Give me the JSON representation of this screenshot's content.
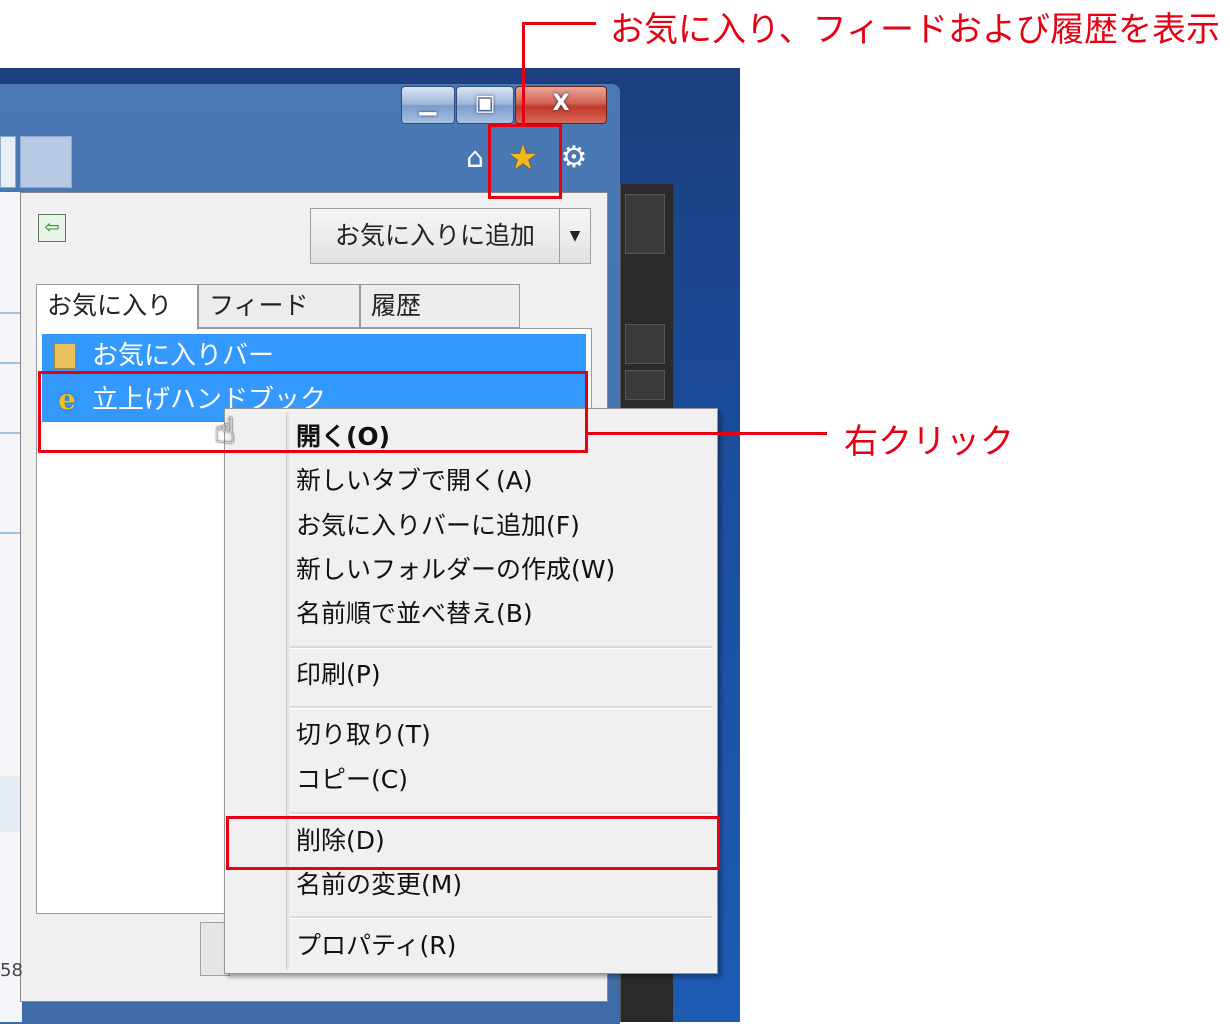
{
  "window": {
    "controls": {
      "minimize": "▁",
      "maximize": "▣",
      "close": "X"
    }
  },
  "toolbar": {
    "home_icon": "⌂",
    "favorites_icon": "★",
    "settings_icon": "⚙"
  },
  "flyout": {
    "pin_icon": "⇦",
    "add_favorites_label": "お気に入りに追加",
    "add_favorites_dropdown": "▼",
    "tabs": [
      {
        "label": "お気に入り"
      },
      {
        "label": "フィード"
      },
      {
        "label": "履歴"
      }
    ],
    "items": [
      {
        "label": "お気に入りバー",
        "icon": "folder-icon"
      },
      {
        "label": "立上げハンドブック",
        "icon": "ie-icon"
      }
    ],
    "status_number": "58"
  },
  "cursor": "☝",
  "context_menu": {
    "items": [
      {
        "label": "開く(O)",
        "bold": true
      },
      {
        "label": "新しいタブで開く(A)"
      },
      {
        "label": "お気に入りバーに追加(F)"
      },
      {
        "label": "新しいフォルダーの作成(W)"
      },
      {
        "label": "名前順で並べ替え(B)"
      },
      {
        "label": "印刷(P)"
      },
      {
        "label": "切り取り(T)"
      },
      {
        "label": "コピー(C)"
      },
      {
        "label": "削除(D)"
      },
      {
        "label": "名前の変更(M)"
      },
      {
        "label": "プロパティ(R)"
      }
    ]
  },
  "annotations": {
    "favorites_callout": "お気に入り、フィードおよび履歴を表示",
    "right_click_callout": "右クリック",
    "accent_color": "#e60012"
  }
}
